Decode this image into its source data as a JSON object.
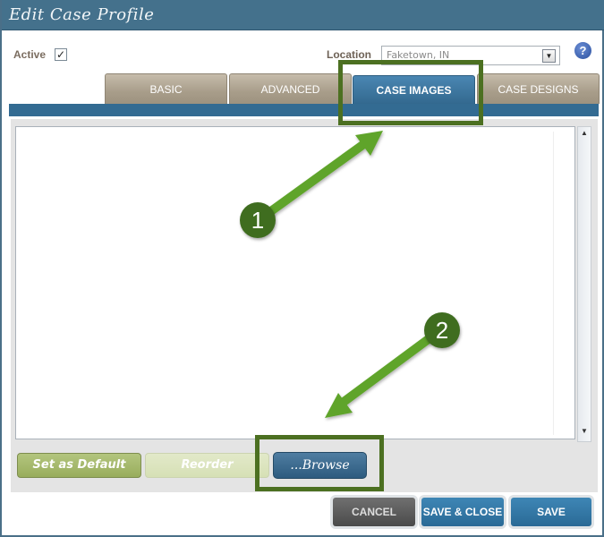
{
  "window": {
    "title": "Edit Case Profile"
  },
  "form": {
    "active_label": "Active",
    "active_checked": true,
    "active_check_glyph": "✓",
    "location_label": "Location",
    "location_value": "Faketown, IN",
    "dropdown_icon": "▼",
    "help_icon": "?"
  },
  "tabs": [
    {
      "label": "BASIC",
      "active": false
    },
    {
      "label": "ADVANCED",
      "active": false
    },
    {
      "label": "CASE IMAGES",
      "active": true
    },
    {
      "label": "CASE DESIGNS",
      "active": false
    }
  ],
  "scrollbar": {
    "up_icon": "▲",
    "down_icon": "▼"
  },
  "image_actions": {
    "set_default_label": "Set as Default",
    "reorder_label": "Reorder",
    "browse_label": "...Browse"
  },
  "footer": {
    "cancel_label": "CANCEL",
    "save_close_label": "SAVE & CLOSE",
    "save_label": "SAVE"
  },
  "annotations": {
    "callout_1": "1",
    "callout_2": "2",
    "highlight_color": "#4c7021",
    "arrow_color": "#5fa42b"
  }
}
